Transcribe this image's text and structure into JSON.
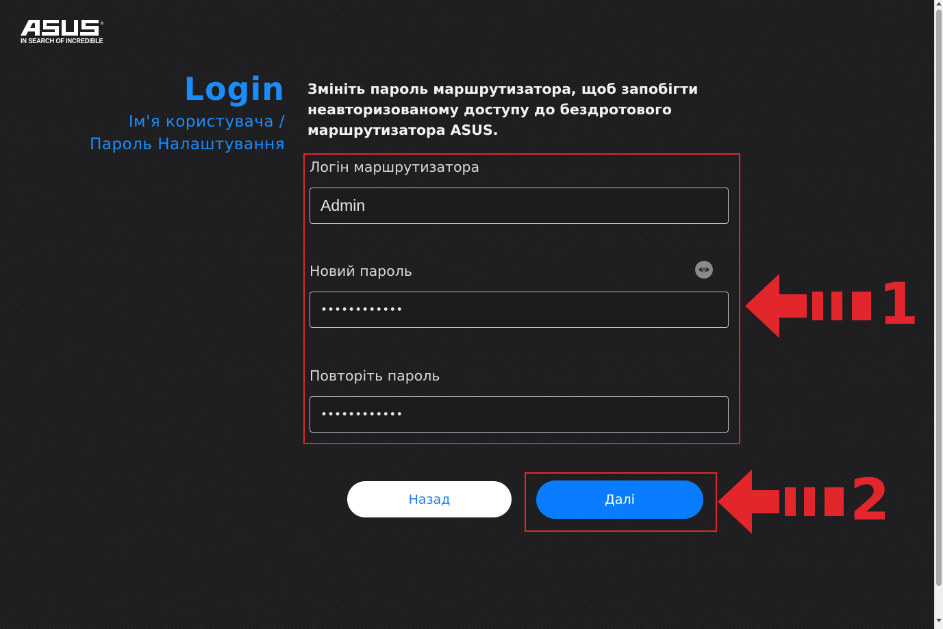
{
  "logo": {
    "brand": "ASUS",
    "tagline": "IN SEARCH OF INCREDIBLE"
  },
  "sidebar": {
    "title": "Login",
    "steps": "Ім'я користувача / Пароль Налаштування"
  },
  "form": {
    "description": "Змініть пароль маршрутизатора, щоб запобігти неавторизованому доступу до бездротового маршрутизатора ASUS.",
    "username": {
      "label": "Логін маршрутизатора",
      "value": "Admin"
    },
    "new_password": {
      "label": "Новий пароль",
      "value": "••••••••••••"
    },
    "confirm_password": {
      "label": "Повторіть пароль",
      "value": "••••••••••••"
    },
    "show_password_icon": "eye-icon"
  },
  "buttons": {
    "back_label": "Назад",
    "next_label": "Далі"
  },
  "annotations": {
    "marker_1": "1",
    "marker_2": "2"
  },
  "colors": {
    "accent": "#1a8cff",
    "primary_button": "#0a7cff",
    "annotation_red": "#e3262c",
    "background": "#1f1f21"
  }
}
